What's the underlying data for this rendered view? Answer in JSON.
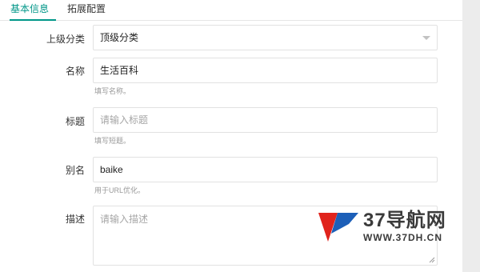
{
  "tabs": [
    {
      "label": "基本信息",
      "active": true
    },
    {
      "label": "拓展配置",
      "active": false
    }
  ],
  "form": {
    "parent": {
      "label": "上级分类",
      "value": "顶级分类"
    },
    "name": {
      "label": "名称",
      "value": "生活百科",
      "hint": "填写名称。"
    },
    "title": {
      "label": "标题",
      "placeholder": "请输入标题",
      "hint": "填写短题。"
    },
    "alias": {
      "label": "别名",
      "value": "baike",
      "hint": "用于URL优化。"
    },
    "description": {
      "label": "描述",
      "placeholder": "请输入描述"
    }
  },
  "watermark": {
    "title": "37导航网",
    "url": "WWW.37DH.CN"
  },
  "colors": {
    "accent": "#009688",
    "logo_red": "#e0231c",
    "logo_blue": "#1c5fb8"
  }
}
